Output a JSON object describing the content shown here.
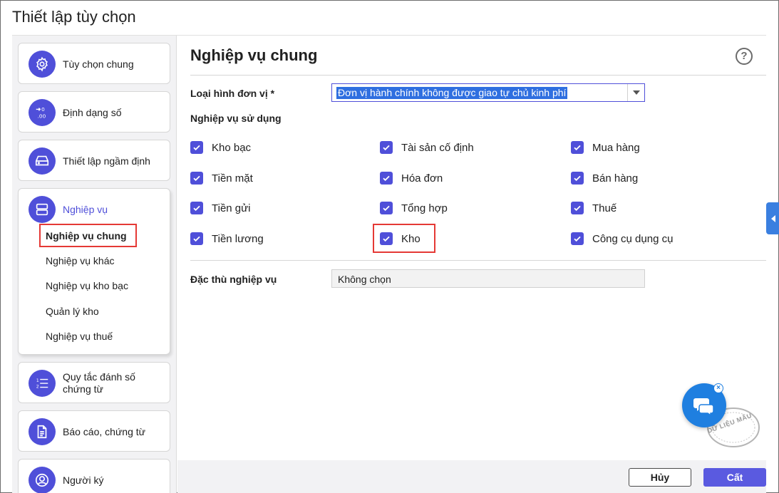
{
  "window": {
    "title": "Thiết lập tùy chọn"
  },
  "sidebar": {
    "items": [
      {
        "label": "Tùy chọn chung",
        "icon": "gear-icon"
      },
      {
        "label": "Định dạng số",
        "icon": "decimal-format-icon"
      },
      {
        "label": "Thiết lập ngầm định",
        "icon": "drive-icon"
      },
      {
        "label": "Nghiệp vụ",
        "icon": "server-icon",
        "active": true,
        "subitems": [
          {
            "label": "Nghiệp vụ chung",
            "selected": true
          },
          {
            "label": "Nghiệp vụ khác"
          },
          {
            "label": "Nghiệp vụ kho bạc"
          },
          {
            "label": "Quản lý kho"
          },
          {
            "label": "Nghiệp vụ thuế"
          }
        ]
      },
      {
        "label_line1": "Quy tắc đánh số",
        "label_line2": "chứng từ",
        "icon": "numbered-list-icon"
      },
      {
        "label": "Báo cáo, chứng từ",
        "icon": "document-icon"
      },
      {
        "label": "Người ký",
        "icon": "person-icon"
      }
    ]
  },
  "main": {
    "title": "Nghiệp vụ chung",
    "help": "?",
    "unit_type": {
      "label": "Loại hình đơn vị *",
      "value": "Đơn vị hành chính không được giao tự chủ kinh phí"
    },
    "operations_label": "Nghiệp vụ sử dụng",
    "checkboxes": [
      {
        "label": "Kho bạc",
        "checked": true
      },
      {
        "label": "Tài sản cố định",
        "checked": true
      },
      {
        "label": "Mua hàng",
        "checked": true
      },
      {
        "label": "Tiền mặt",
        "checked": true
      },
      {
        "label": "Hóa đơn",
        "checked": true
      },
      {
        "label": "Bán hàng",
        "checked": true
      },
      {
        "label": "Tiền gửi",
        "checked": true
      },
      {
        "label": "Tổng hợp",
        "checked": true
      },
      {
        "label": "Thuế",
        "checked": true
      },
      {
        "label": "Tiền lương",
        "checked": true
      },
      {
        "label": "Kho",
        "checked": true
      },
      {
        "label": "Công cụ dụng cụ",
        "checked": true
      }
    ],
    "special": {
      "label": "Đặc thù nghiệp vụ",
      "value": "Không chọn"
    }
  },
  "footer": {
    "cancel_label": "Hủy",
    "cut_label": "Cất"
  },
  "watermark": {
    "text": "DỮ LIỆU MẪU"
  },
  "colors": {
    "accent": "#4f4fd9",
    "highlight": "#e53935",
    "selection": "#2f6fe0",
    "chat": "#1f7fe0"
  }
}
